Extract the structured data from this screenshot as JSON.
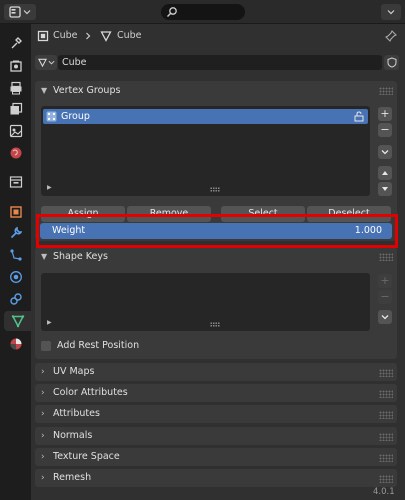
{
  "breadcrumb": {
    "object": "Cube",
    "data": "Cube"
  },
  "mesh_name": {
    "value": "Cube"
  },
  "vertex_groups": {
    "title": "Vertex Groups",
    "items": [
      {
        "label": "Group"
      }
    ],
    "buttons": {
      "assign": "Assign",
      "remove": "Remove",
      "select": "Select",
      "deselect": "Deselect"
    },
    "weight": {
      "label": "Weight",
      "value": "1.000"
    }
  },
  "shape_keys": {
    "title": "Shape Keys",
    "add_rest_position": "Add Rest Position"
  },
  "collapsed_panels": [
    "UV Maps",
    "Color Attributes",
    "Attributes",
    "Normals",
    "Texture Space",
    "Remesh"
  ],
  "version": "4.0.1",
  "colors": {
    "accent": "#4772b3",
    "highlight_box": "#e20000"
  }
}
